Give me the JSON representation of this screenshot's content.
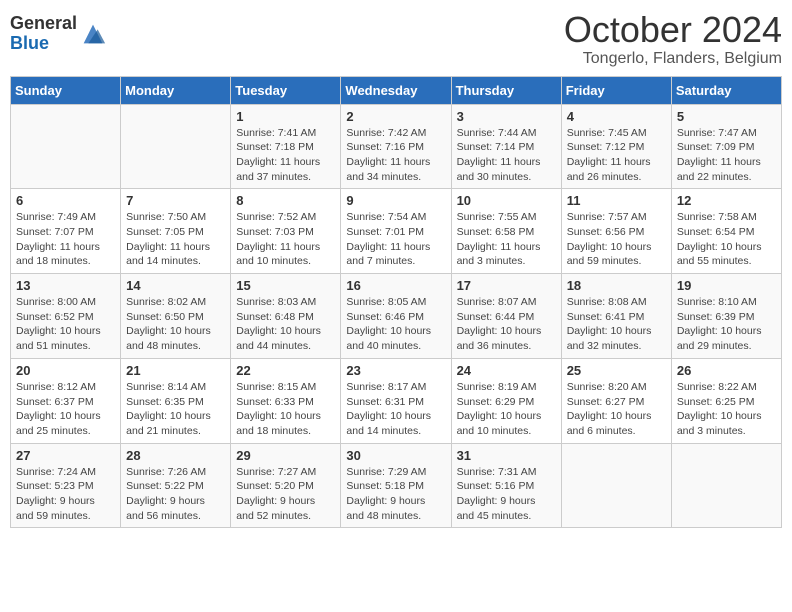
{
  "header": {
    "logo_general": "General",
    "logo_blue": "Blue",
    "title": "October 2024",
    "location": "Tongerlo, Flanders, Belgium"
  },
  "days_of_week": [
    "Sunday",
    "Monday",
    "Tuesday",
    "Wednesday",
    "Thursday",
    "Friday",
    "Saturday"
  ],
  "weeks": [
    [
      {
        "day": "",
        "info": ""
      },
      {
        "day": "",
        "info": ""
      },
      {
        "day": "1",
        "info": "Sunrise: 7:41 AM\nSunset: 7:18 PM\nDaylight: 11 hours and 37 minutes."
      },
      {
        "day": "2",
        "info": "Sunrise: 7:42 AM\nSunset: 7:16 PM\nDaylight: 11 hours and 34 minutes."
      },
      {
        "day": "3",
        "info": "Sunrise: 7:44 AM\nSunset: 7:14 PM\nDaylight: 11 hours and 30 minutes."
      },
      {
        "day": "4",
        "info": "Sunrise: 7:45 AM\nSunset: 7:12 PM\nDaylight: 11 hours and 26 minutes."
      },
      {
        "day": "5",
        "info": "Sunrise: 7:47 AM\nSunset: 7:09 PM\nDaylight: 11 hours and 22 minutes."
      }
    ],
    [
      {
        "day": "6",
        "info": "Sunrise: 7:49 AM\nSunset: 7:07 PM\nDaylight: 11 hours and 18 minutes."
      },
      {
        "day": "7",
        "info": "Sunrise: 7:50 AM\nSunset: 7:05 PM\nDaylight: 11 hours and 14 minutes."
      },
      {
        "day": "8",
        "info": "Sunrise: 7:52 AM\nSunset: 7:03 PM\nDaylight: 11 hours and 10 minutes."
      },
      {
        "day": "9",
        "info": "Sunrise: 7:54 AM\nSunset: 7:01 PM\nDaylight: 11 hours and 7 minutes."
      },
      {
        "day": "10",
        "info": "Sunrise: 7:55 AM\nSunset: 6:58 PM\nDaylight: 11 hours and 3 minutes."
      },
      {
        "day": "11",
        "info": "Sunrise: 7:57 AM\nSunset: 6:56 PM\nDaylight: 10 hours and 59 minutes."
      },
      {
        "day": "12",
        "info": "Sunrise: 7:58 AM\nSunset: 6:54 PM\nDaylight: 10 hours and 55 minutes."
      }
    ],
    [
      {
        "day": "13",
        "info": "Sunrise: 8:00 AM\nSunset: 6:52 PM\nDaylight: 10 hours and 51 minutes."
      },
      {
        "day": "14",
        "info": "Sunrise: 8:02 AM\nSunset: 6:50 PM\nDaylight: 10 hours and 48 minutes."
      },
      {
        "day": "15",
        "info": "Sunrise: 8:03 AM\nSunset: 6:48 PM\nDaylight: 10 hours and 44 minutes."
      },
      {
        "day": "16",
        "info": "Sunrise: 8:05 AM\nSunset: 6:46 PM\nDaylight: 10 hours and 40 minutes."
      },
      {
        "day": "17",
        "info": "Sunrise: 8:07 AM\nSunset: 6:44 PM\nDaylight: 10 hours and 36 minutes."
      },
      {
        "day": "18",
        "info": "Sunrise: 8:08 AM\nSunset: 6:41 PM\nDaylight: 10 hours and 32 minutes."
      },
      {
        "day": "19",
        "info": "Sunrise: 8:10 AM\nSunset: 6:39 PM\nDaylight: 10 hours and 29 minutes."
      }
    ],
    [
      {
        "day": "20",
        "info": "Sunrise: 8:12 AM\nSunset: 6:37 PM\nDaylight: 10 hours and 25 minutes."
      },
      {
        "day": "21",
        "info": "Sunrise: 8:14 AM\nSunset: 6:35 PM\nDaylight: 10 hours and 21 minutes."
      },
      {
        "day": "22",
        "info": "Sunrise: 8:15 AM\nSunset: 6:33 PM\nDaylight: 10 hours and 18 minutes."
      },
      {
        "day": "23",
        "info": "Sunrise: 8:17 AM\nSunset: 6:31 PM\nDaylight: 10 hours and 14 minutes."
      },
      {
        "day": "24",
        "info": "Sunrise: 8:19 AM\nSunset: 6:29 PM\nDaylight: 10 hours and 10 minutes."
      },
      {
        "day": "25",
        "info": "Sunrise: 8:20 AM\nSunset: 6:27 PM\nDaylight: 10 hours and 6 minutes."
      },
      {
        "day": "26",
        "info": "Sunrise: 8:22 AM\nSunset: 6:25 PM\nDaylight: 10 hours and 3 minutes."
      }
    ],
    [
      {
        "day": "27",
        "info": "Sunrise: 7:24 AM\nSunset: 5:23 PM\nDaylight: 9 hours and 59 minutes."
      },
      {
        "day": "28",
        "info": "Sunrise: 7:26 AM\nSunset: 5:22 PM\nDaylight: 9 hours and 56 minutes."
      },
      {
        "day": "29",
        "info": "Sunrise: 7:27 AM\nSunset: 5:20 PM\nDaylight: 9 hours and 52 minutes."
      },
      {
        "day": "30",
        "info": "Sunrise: 7:29 AM\nSunset: 5:18 PM\nDaylight: 9 hours and 48 minutes."
      },
      {
        "day": "31",
        "info": "Sunrise: 7:31 AM\nSunset: 5:16 PM\nDaylight: 9 hours and 45 minutes."
      },
      {
        "day": "",
        "info": ""
      },
      {
        "day": "",
        "info": ""
      }
    ]
  ]
}
